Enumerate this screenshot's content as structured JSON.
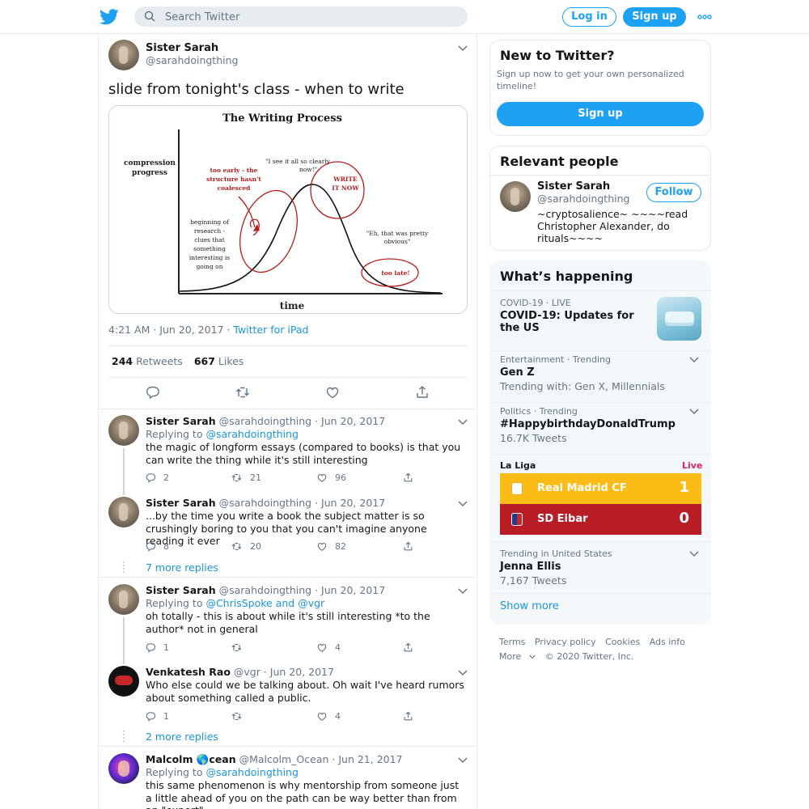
{
  "topbar": {
    "search_placeholder": "Search Twitter",
    "login_label": "Log in",
    "signup_label": "Sign up"
  },
  "main_tweet": {
    "name": "Sister Sarah",
    "handle": "@sarahdoingthing",
    "text": "slide from tonight's class - when to write",
    "media": {
      "title": "The Writing Process",
      "y_label_1": "compression",
      "y_label_2": "progress",
      "x_label": "time",
      "note_early_1": "too early - the",
      "note_early_2": "structure hasn't",
      "note_early_3": "coalesced",
      "note_see_1": "\"I see it all so clearly",
      "note_see_2": "now!\"",
      "note_write_1": "WRITE",
      "note_write_2": "IT NOW",
      "note_begin_1": "beginning of",
      "note_begin_2": "research -",
      "note_begin_3": "clues that",
      "note_begin_4": "something",
      "note_begin_5": "interesting is",
      "note_begin_6": "going on",
      "note_eh_1": "\"Eh, that was pretty",
      "note_eh_2": "obvious\"",
      "note_late": "too late!"
    },
    "time": "4:21 AM · Jun 20, 2017 · ",
    "source": "Twitter for iPad",
    "retweets": "244",
    "retweets_label": "Retweets",
    "likes": "667",
    "likes_label": "Likes"
  },
  "replies": [
    {
      "name": "Sister Sarah",
      "meta": "@sarahdoingthing · Jun 20, 2017",
      "replying_prefix": "Replying to ",
      "replying_to": "@sarahdoingthing",
      "text": "the magic of longform essays (compared to books) is that you can write the thing while it's still interesting",
      "reply_count": "2",
      "retweet_count": "21",
      "like_count": "96"
    },
    {
      "name": "Sister Sarah",
      "meta": "@sarahdoingthing · Jun 20, 2017",
      "text": "...by the time you write a book the subject matter is so crushingly boring to you that you can't imagine anyone reading it ever",
      "reply_count": "8",
      "retweet_count": "20",
      "like_count": "82"
    },
    {
      "name": "Sister Sarah",
      "meta": "@sarahdoingthing · Jun 20, 2017",
      "replying_prefix": "Replying to ",
      "replying_to": "@ChrisSpoke and @vgr",
      "text": "oh totally - this is about while it's still interesting *to the author* not in general",
      "reply_count": "1",
      "retweet_count": "",
      "like_count": "4"
    },
    {
      "name": "Venkatesh Rao",
      "meta": "@vgr · Jun 20, 2017",
      "text": "Who else could we be talking about. Oh wait I've heard rumors about something called a public.",
      "reply_count": "1",
      "retweet_count": "",
      "like_count": "4"
    },
    {
      "name": "Malcolm 🌎cean",
      "meta": "@Malcolm_Ocean · Jun 21, 2017",
      "replying_prefix": "Replying to ",
      "replying_to": "@sarahdoingthing",
      "text": "this same phenomenon is why mentorship from someone just a little ahead of you on the path can be way better than from an \"expert\""
    }
  ],
  "more_replies_1": "7 more replies",
  "more_replies_2": "2 more replies",
  "sidebar": {
    "new": {
      "title": "New to Twitter?",
      "desc": "Sign up now to get your own personalized timeline!",
      "signup_label": "Sign up"
    },
    "relevant": {
      "title": "Relevant people",
      "name": "Sister Sarah",
      "handle": "@sarahdoingthing",
      "bio": "~cryptosalience~ ~~~~read Christopher Alexander, do rituals~~~~",
      "follow_label": "Follow"
    },
    "happening": {
      "title": "What’s happening",
      "trends": [
        {
          "cat": "COVID-19 · LIVE",
          "title": "COVID-19: Updates for the US"
        },
        {
          "cat": "Entertainment · Trending",
          "title": "Gen Z",
          "sub": "Trending with: Gen X, Millennials"
        },
        {
          "cat": "Politics · Trending",
          "title": "#HappybirthdayDonaldTrump",
          "sub": "16.7K Tweets"
        },
        {
          "cat": "Trending in United States",
          "title": "Jenna Ellis",
          "sub": "7,167 Tweets"
        }
      ],
      "liga": {
        "label": "La Liga",
        "live": "Live",
        "home": "Real Madrid CF",
        "home_score": "1",
        "away": "SD Eibar",
        "away_score": "0",
        "home_color": "#fbbc16",
        "away_color": "#b81d25"
      },
      "show_more": "Show more"
    }
  },
  "footer": {
    "terms": "Terms",
    "privacy": "Privacy policy",
    "cookies": "Cookies",
    "ads": "Ads info",
    "more": "More",
    "copyright": "© 2020 Twitter, Inc."
  },
  "colors": {
    "accent": "#1da1f2",
    "link": "#1b95e0",
    "muted": "#657786",
    "live": "#e0245e"
  }
}
